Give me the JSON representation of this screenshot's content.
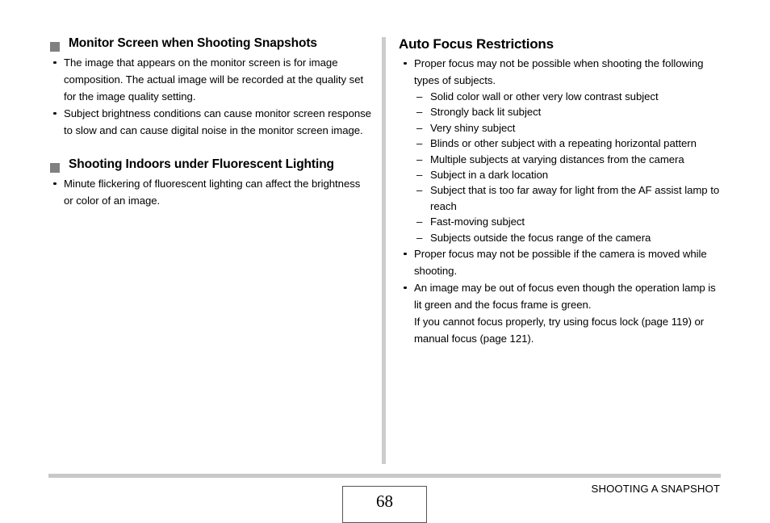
{
  "document": {
    "page_number": "68",
    "footer_title": "SHOOTING A SNAPSHOT",
    "square_bullet_color": "#808080",
    "rule_color": "#c8c8c8",
    "divider_color": "#cccccc"
  },
  "left_column": {
    "section1": {
      "heading": "Monitor Screen when Shooting Snapshots",
      "bullets": [
        "The image that appears on the monitor screen is for image composition. The actual image will be recorded at the quality set for the image quality setting.",
        "Subject brightness conditions can cause monitor screen response to slow and can cause digital noise in the monitor screen image."
      ]
    },
    "section2": {
      "heading": "Shooting Indoors under Fluorescent Lighting",
      "bullets": [
        "Minute flickering of fluorescent lighting can affect the brightness or color of an image."
      ]
    }
  },
  "right_column": {
    "heading": "Auto Focus Restrictions",
    "bullet1": "Proper focus may not be possible when shooting the following types of subjects.",
    "sub_items": [
      "Solid color wall or other very low contrast subject",
      "Strongly back lit subject",
      "Very shiny subject",
      "Blinds or other subject with a repeating horizontal pattern",
      "Multiple subjects at varying distances from the camera",
      "Subject in a dark location",
      "Subject that is too far away for light from the AF assist lamp to reach",
      "Fast-moving subject",
      "Subjects outside the focus range of the camera"
    ],
    "bullet2": "Proper focus may not be possible if the camera is moved while shooting.",
    "bullet3_line1": "An image may be out of focus even though the operation lamp is lit green and the focus frame is green.",
    "bullet3_line2": "If you cannot focus properly, try using focus lock (page 119) or manual focus (page 121).",
    "dash_glyph": "–"
  }
}
